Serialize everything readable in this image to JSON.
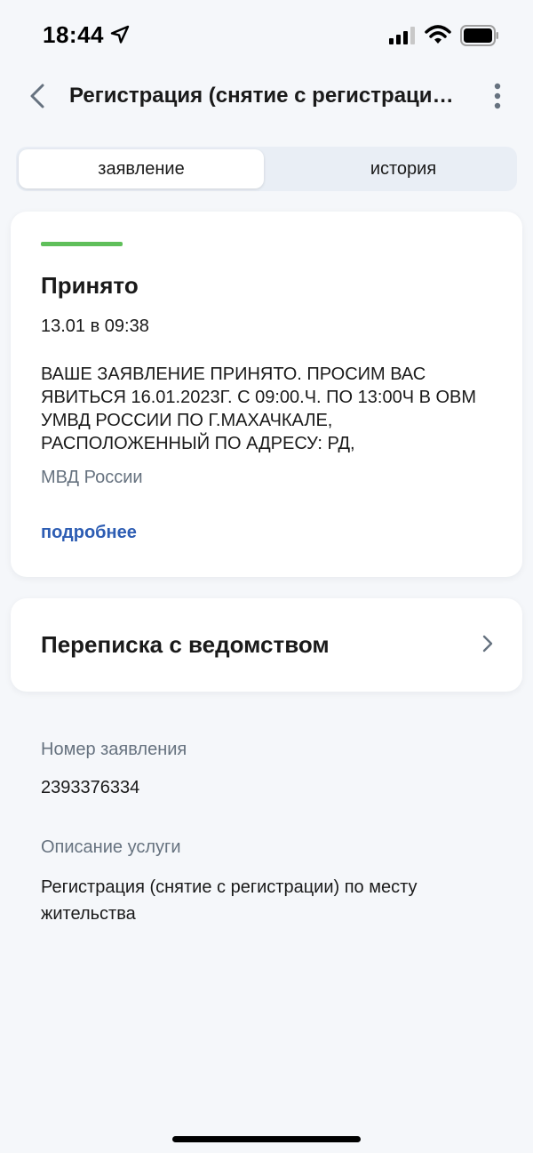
{
  "status_bar": {
    "time": "18:44",
    "icons": [
      "location-arrow-icon",
      "cellular-signal-icon",
      "wifi-icon",
      "battery-icon"
    ]
  },
  "nav": {
    "title": "Регистрация (снятие с регистрации) по месту жительства",
    "back_icon": "chevron-left-icon",
    "more_icon": "more-vertical-icon"
  },
  "tabs": [
    {
      "label": "заявление",
      "active": true
    },
    {
      "label": "история",
      "active": false
    }
  ],
  "status_card": {
    "status_color": "#5fbf5a",
    "title": "Принято",
    "date": "13.01 в 09:38",
    "message": "ВАШЕ ЗАЯВЛЕНИЕ ПРИНЯТО. ПРОСИМ ВАС ЯВИТЬСЯ 16.01.2023Г. С 09:00.Ч. ПО 13:00Ч В ОВМ УМВД РОССИИ ПО Г.МАХАЧКАЛЕ, РАСПОЛОЖЕННЫЙ ПО АДРЕСУ: РД,",
    "organization": "МВД России",
    "more_link": "подробнее"
  },
  "correspondence": {
    "title": "Переписка с ведомством",
    "icon": "chevron-right-icon"
  },
  "details": {
    "number_label": "Номер заявления",
    "number_value": "2393376334",
    "description_label": "Описание услуги",
    "description_value": "Регистрация (снятие с регистрации) по месту жительства"
  },
  "colors": {
    "accent_link": "#2d5db3",
    "background": "#f5f7fa",
    "muted_text": "#66727f"
  }
}
